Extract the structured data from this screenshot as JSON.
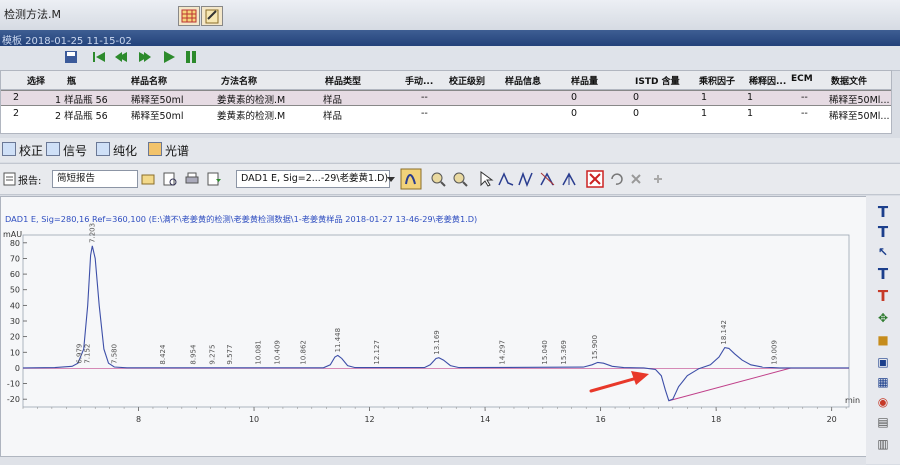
{
  "window": {
    "title": "检测方法.M"
  },
  "header": {
    "status": "模板 2018-01-25 11-15-02"
  },
  "sample_table": {
    "columns": [
      "选择",
      "瓶",
      "样品名称",
      "方法名称",
      "样品类型",
      "手动...",
      "校正级别",
      "样品信息",
      "样品量",
      "ISTD 含量",
      "乘积因子",
      "稀释因...",
      "ECM",
      "数据文件"
    ],
    "rows": [
      [
        "2",
        "1 样品瓶 56",
        "稀释至50ml",
        "姜黄素的检测.M",
        "样品",
        "--",
        "",
        "",
        "0",
        "0",
        "1",
        "1",
        "--",
        "稀释至50Ml..."
      ],
      [
        "2",
        "2 样品瓶 56",
        "稀释至50ml",
        "姜黄素的检测.M",
        "样品",
        "--",
        "",
        "",
        "0",
        "0",
        "1",
        "1",
        "--",
        "稀释至50Ml..."
      ]
    ]
  },
  "tabs": [
    {
      "label": "校正"
    },
    {
      "label": "信号"
    },
    {
      "label": "纯化"
    },
    {
      "label": "光谱"
    }
  ],
  "report": {
    "label": "报告:",
    "report_type": "简短报告",
    "signal_select": "DAD1 E, Sig=2...-29\\老姜黄1.D)"
  },
  "chart_data": {
    "type": "line",
    "title": "DAD1 E, Sig=280,16 Ref=360,100 (E:\\满不\\老姜黄的检测\\老姜黄检测数据\\1-老姜黄样品 2018-01-27 13-46-29\\老姜黄1.D)",
    "ylabel": "mAU",
    "xlabel": "min",
    "xlim": [
      6.0,
      20.3
    ],
    "ylim": [
      -25,
      85
    ],
    "x_ticks": [
      8,
      10,
      12,
      14,
      16,
      18,
      20
    ],
    "y_ticks": [
      80,
      70,
      60,
      50,
      40,
      30,
      20,
      10,
      0,
      -10,
      -20
    ],
    "x_tick_labels": [
      "8",
      "10",
      "12",
      "14",
      "16",
      "18",
      "20"
    ],
    "y_tick_labels": [
      "80",
      "70",
      "60",
      "50",
      "40",
      "30",
      "20",
      "10",
      "0",
      "-10",
      "-20"
    ],
    "trace": [
      [
        6.0,
        0.0
      ],
      [
        6.55,
        0.2
      ],
      [
        6.85,
        1.0
      ],
      [
        6.95,
        3
      ],
      [
        7.05,
        12
      ],
      [
        7.12,
        40
      ],
      [
        7.17,
        72
      ],
      [
        7.2,
        78
      ],
      [
        7.25,
        70
      ],
      [
        7.32,
        40
      ],
      [
        7.4,
        12
      ],
      [
        7.48,
        3
      ],
      [
        7.58,
        0.6
      ],
      [
        7.8,
        0.1
      ],
      [
        11.2,
        0.1
      ],
      [
        11.32,
        2
      ],
      [
        11.4,
        7
      ],
      [
        11.45,
        8
      ],
      [
        11.52,
        6
      ],
      [
        11.62,
        1.5
      ],
      [
        11.75,
        0.2
      ],
      [
        12.95,
        0.2
      ],
      [
        13.05,
        2
      ],
      [
        13.15,
        6
      ],
      [
        13.2,
        6.5
      ],
      [
        13.28,
        5
      ],
      [
        13.4,
        1.5
      ],
      [
        13.55,
        0.2
      ],
      [
        15.7,
        0.5
      ],
      [
        15.85,
        2
      ],
      [
        15.95,
        3.5
      ],
      [
        16.05,
        3
      ],
      [
        16.2,
        1
      ],
      [
        16.4,
        0.2
      ],
      [
        16.75,
        0.0
      ],
      [
        16.95,
        -1
      ],
      [
        17.05,
        -5
      ],
      [
        17.12,
        -14
      ],
      [
        17.18,
        -21
      ],
      [
        17.25,
        -20
      ],
      [
        17.35,
        -12
      ],
      [
        17.5,
        -5
      ],
      [
        17.7,
        -0.5
      ],
      [
        17.9,
        2
      ],
      [
        18.05,
        7
      ],
      [
        18.15,
        13
      ],
      [
        18.22,
        12.5
      ],
      [
        18.32,
        9
      ],
      [
        18.45,
        5
      ],
      [
        18.6,
        2
      ],
      [
        18.8,
        0.5
      ],
      [
        19.1,
        0.0
      ],
      [
        20.3,
        0.0
      ]
    ],
    "baseline_segment": [
      [
        17.18,
        -21
      ],
      [
        19.3,
        0.0
      ]
    ],
    "peak_labels": [
      {
        "rt": "6.979",
        "x": 6.98,
        "y": 0.8
      },
      {
        "rt": "7.152",
        "x": 7.12,
        "y": 0.8
      },
      {
        "rt": "7.203",
        "x": 7.2,
        "y": 78
      },
      {
        "rt": "7.580",
        "x": 7.58,
        "y": 0.6
      },
      {
        "rt": "8.424",
        "x": 8.42,
        "y": 0.2
      },
      {
        "rt": "8.954",
        "x": 8.95,
        "y": 0.2
      },
      {
        "rt": "9.275",
        "x": 9.28,
        "y": 0.2
      },
      {
        "rt": "9.577",
        "x": 9.58,
        "y": 0.2
      },
      {
        "rt": "10.081",
        "x": 10.08,
        "y": 0.2
      },
      {
        "rt": "10.409",
        "x": 10.41,
        "y": 0.2
      },
      {
        "rt": "10.862",
        "x": 10.86,
        "y": 0.2
      },
      {
        "rt": "11.448",
        "x": 11.45,
        "y": 8
      },
      {
        "rt": "12.127",
        "x": 12.13,
        "y": 0.2
      },
      {
        "rt": "13.169",
        "x": 13.17,
        "y": 6.5
      },
      {
        "rt": "14.297",
        "x": 14.3,
        "y": 0.2
      },
      {
        "rt": "15.040",
        "x": 15.04,
        "y": 0.2
      },
      {
        "rt": "15.369",
        "x": 15.37,
        "y": 0.2
      },
      {
        "rt": "15.900",
        "x": 15.9,
        "y": 3.5
      },
      {
        "rt": "18.142",
        "x": 18.14,
        "y": 13
      },
      {
        "rt": "19.009",
        "x": 19.01,
        "y": 0.2
      }
    ],
    "colors": {
      "trace": "#3d4fa8",
      "baseline": "#c0408a",
      "annotation_arrow": "#e8382a",
      "title": "#2f4ec0"
    }
  }
}
